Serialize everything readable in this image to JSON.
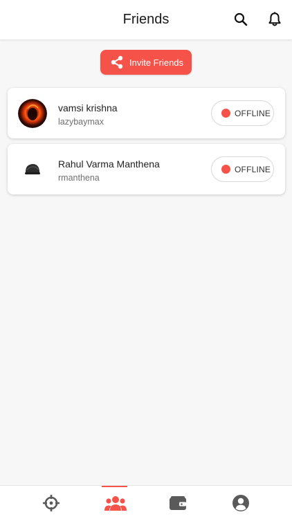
{
  "header": {
    "title": "Friends",
    "search_icon": "search-icon",
    "notification_icon": "bell-icon"
  },
  "invite": {
    "label": "Invite Friends",
    "icon": "share-icon",
    "color": "#f5534a"
  },
  "friends": [
    {
      "name": "vamsi krishna",
      "username": "lazybaymax",
      "status": "OFFLINE",
      "status_color": "#f5534a"
    },
    {
      "name": "Rahul Varma Manthena",
      "username": "rmanthena",
      "status": "OFFLINE",
      "status_color": "#f5534a"
    }
  ],
  "bottom_nav": {
    "items": [
      {
        "icon": "crosshair-icon",
        "active": false
      },
      {
        "icon": "friends-icon",
        "active": true
      },
      {
        "icon": "wallet-icon",
        "active": false
      },
      {
        "icon": "profile-icon",
        "active": false
      }
    ],
    "active_color": "#f5534a",
    "inactive_color": "#5a5a5a"
  }
}
